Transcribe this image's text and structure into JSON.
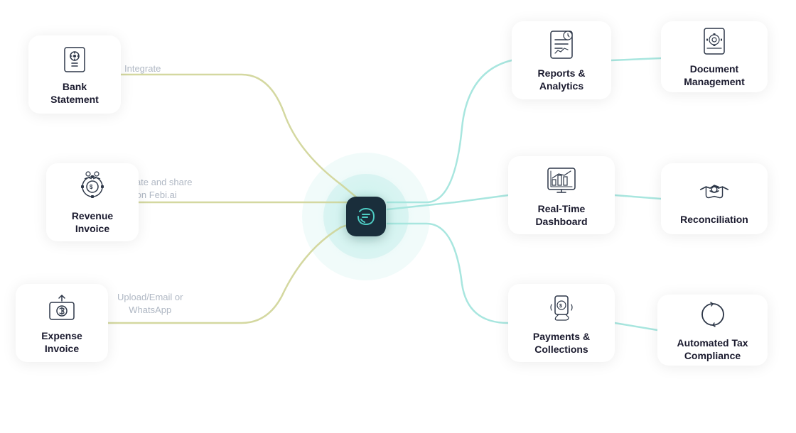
{
  "app": {
    "center_brand": "F"
  },
  "left_cards": [
    {
      "id": "bank-statement",
      "label": "Bank\nStatement",
      "label_line1": "Bank",
      "label_line2": "Statement",
      "connector_label_line1": "Integrate",
      "connector_label_line2": ""
    },
    {
      "id": "revenue-invoice",
      "label": "Revenue\nInvoice",
      "label_line1": "Revenue",
      "label_line2": "Invoice",
      "connector_label_line1": "Create and share",
      "connector_label_line2": "on Febi.ai"
    },
    {
      "id": "expense-invoice",
      "label": "Expense\nInvoice",
      "label_line1": "Expense",
      "label_line2": "Invoice",
      "connector_label_line1": "Upload/Email or",
      "connector_label_line2": "WhatsApp"
    }
  ],
  "right_cards_primary": [
    {
      "id": "reports-analytics",
      "label_line1": "Reports &",
      "label_line2": "Analytics"
    },
    {
      "id": "real-time-dashboard",
      "label_line1": "Real-Time",
      "label_line2": "Dashboard"
    },
    {
      "id": "payments-collections",
      "label_line1": "Payments &",
      "label_line2": "Collections"
    }
  ],
  "right_cards_secondary": [
    {
      "id": "document-management",
      "label_line1": "Document",
      "label_line2": "Management"
    },
    {
      "id": "reconciliation",
      "label_line1": "Reconciliation",
      "label_line2": ""
    },
    {
      "id": "automated-tax-compliance",
      "label_line1": "Automated Tax",
      "label_line2": "Compliance"
    }
  ],
  "colors": {
    "accent_teal": "#4ecdc4",
    "accent_yellow": "#f0e68c",
    "card_shadow": "rgba(0,0,0,0.08)",
    "text_dark": "#1a1a2e",
    "text_label": "#b0b8c4"
  }
}
